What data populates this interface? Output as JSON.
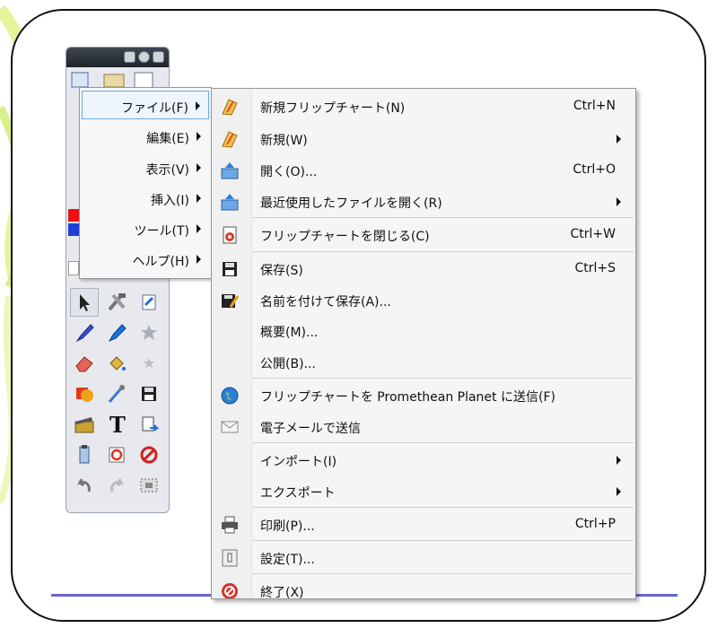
{
  "left_menu": {
    "items": [
      {
        "label": "ファイル(F)",
        "active": true
      },
      {
        "label": "編集(E)"
      },
      {
        "label": "表示(V)"
      },
      {
        "label": "挿入(I)"
      },
      {
        "label": "ツール(T)"
      },
      {
        "label": "ヘルプ(H)"
      }
    ]
  },
  "file_menu": {
    "items": [
      {
        "label": "新規フリップチャート(N)",
        "shortcut": "Ctrl+N",
        "icon": "new-flipchart-icon"
      },
      {
        "label": "新規(W)",
        "icon": "new-icon",
        "submenu": true
      },
      {
        "label": "開く(O)...",
        "shortcut": "Ctrl+O",
        "icon": "open-icon"
      },
      {
        "label": "最近使用したファイルを開く(R)",
        "icon": "open-recent-icon",
        "submenu": true
      },
      {
        "label": "フリップチャートを閉じる(C)",
        "shortcut": "Ctrl+W",
        "icon": "close-flipchart-icon"
      },
      {
        "label": "保存(S)",
        "shortcut": "Ctrl+S",
        "icon": "save-icon"
      },
      {
        "label": "名前を付けて保存(A)...",
        "icon": "save-as-icon"
      },
      {
        "label": "概要(M)..."
      },
      {
        "label": "公開(B)..."
      },
      {
        "label": "フリップチャートを Promethean Planet に送信(F)",
        "icon": "globe-icon"
      },
      {
        "label": "電子メールで送信",
        "icon": "envelope-icon"
      },
      {
        "label": "インポート(I)",
        "submenu": true
      },
      {
        "label": "エクスポート",
        "submenu": true
      },
      {
        "label": "印刷(P)...",
        "shortcut": "Ctrl+P",
        "icon": "printer-icon"
      },
      {
        "label": "設定(T)...",
        "icon": "settings-icon"
      },
      {
        "label": "終了(X)",
        "icon": "exit-icon"
      }
    ]
  },
  "colors": {
    "frame_line": "#6666cc",
    "highlight_border": "#6da7e0",
    "deco_green": "#d9f27a"
  }
}
